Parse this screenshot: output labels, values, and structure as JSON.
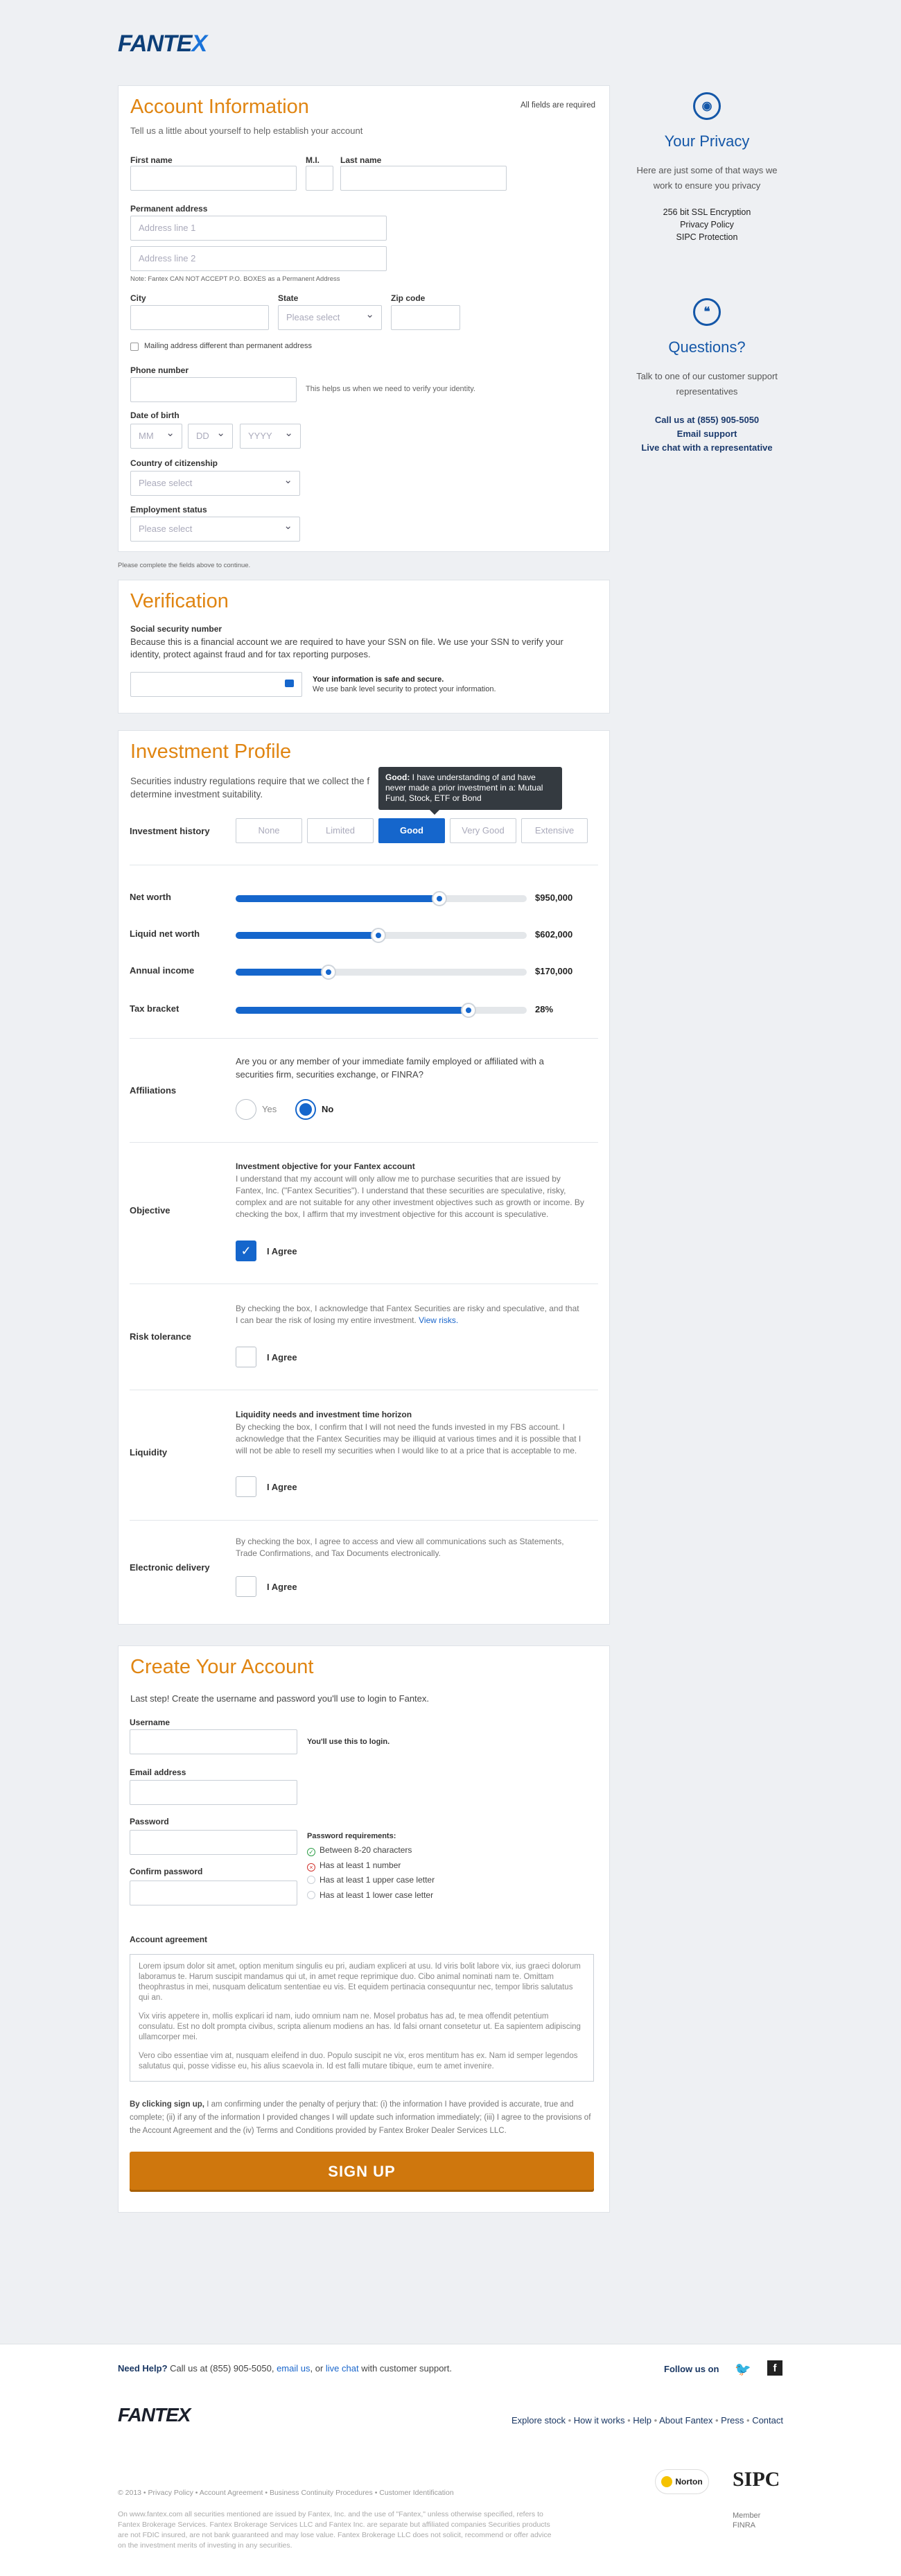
{
  "brand": {
    "logo_main": "FANTE",
    "logo_x": "X"
  },
  "account": {
    "title": "Account Information",
    "required_note": "All fields are required",
    "subtitle": "Tell us a little about yourself to help establish your account",
    "first_name_label": "First name",
    "mi_label": "M.I.",
    "last_name_label": "Last name",
    "address_label": "Permanent address",
    "address1_placeholder": "Address line 1",
    "address2_placeholder": "Address line 2",
    "address_note": "Note: Fantex CAN NOT ACCEPT P.O. BOXES as a Permanent Address",
    "city_label": "City",
    "state_label": "State",
    "state_placeholder": "Please select",
    "zip_label": "Zip code",
    "mailing_label": "Mailing address different than permanent address",
    "phone_label": "Phone number",
    "phone_help": "This helps us when we need to verify your identity.",
    "dob_label": "Date of birth",
    "dob_mm": "MM",
    "dob_dd": "DD",
    "dob_yyyy": "YYYY",
    "citizenship_label": "Country of citizenship",
    "citizenship_placeholder": "Please select",
    "employment_label": "Employment status",
    "employment_placeholder": "Please select",
    "complete_note": "Please complete the fields above to continue."
  },
  "verification": {
    "title": "Verification",
    "ssn_label": "Social security number",
    "ssn_text": "Because this is a financial account we are required to have your SSN on file. We use your SSN to verify your identity, protect against fraud and for tax reporting purposes.",
    "safe_title": "Your information is safe and secure.",
    "safe_text": "We use bank level security to protect your information."
  },
  "investment": {
    "title": "Investment Profile",
    "subtitle_1": "Securities industry regulations require that we collect the f",
    "subtitle_2": "determine investment suitability.",
    "tooltip_bold": "Good:",
    "tooltip_text": " I have understanding of and have never made a prior investment in a: Mutual Fund, Stock, ETF or Bond",
    "history_label": "Investment history",
    "history_options": [
      "None",
      "Limited",
      "Good",
      "Very Good",
      "Extensive"
    ],
    "history_selected": "Good",
    "sliders": [
      {
        "label": "Net worth",
        "value": "$950,000",
        "fraction": 0.7
      },
      {
        "label": "Liquid net worth",
        "value": "$602,000",
        "fraction": 0.49
      },
      {
        "label": "Annual income",
        "value": "$170,000",
        "fraction": 0.32
      },
      {
        "label": "Tax bracket",
        "value": "28%",
        "fraction": 0.8
      }
    ],
    "affiliations_label": "Affiliations",
    "affiliations_q": "Are you or any member of your immediate family employed or affiliated with a securities firm, securities exchange, or FINRA?",
    "yes": "Yes",
    "no": "No",
    "objective_label": "Objective",
    "objective_title": "Investment objective for your Fantex account",
    "objective_text": "I understand that my account will only allow me to purchase securities that are issued by Fantex, Inc. (\"Fantex Securities\"). I understand that these securities are speculative, risky, complex and are not suitable for any other investment objectives such as growth or income. By checking the box, I affirm that my investment objective for this account is speculative.",
    "agree": "I Agree",
    "risk_label": "Risk tolerance",
    "risk_text": "By checking the box, I acknowledge that Fantex Securities are risky and speculative, and that I can bear the risk of losing my entire investment.",
    "risk_link": "View risks.",
    "liquidity_label": "Liquidity",
    "liquidity_title": "Liquidity needs and investment time horizon",
    "liquidity_text": "By checking the box, I confirm that I will not need the funds invested in my FBS account. I acknowledge that the Fantex Securities may be illiquid at various times and it is possible that I will not be able to resell my securities when I would like to at a price that is acceptable to me.",
    "delivery_label": "Electronic delivery",
    "delivery_text": "By checking the box, I agree to access and view all communications such as Statements, Trade Confirmations, and Tax Documents electronically."
  },
  "create": {
    "title": "Create Your Account",
    "subtitle": "Last step! Create the username and password you'll use to login to Fantex.",
    "username_label": "Username",
    "username_help": "You'll use this to login.",
    "email_label": "Email address",
    "password_label": "Password",
    "confirm_label": "Confirm password",
    "req_title": "Password requirements:",
    "requirements": [
      "Between 8-20 characters",
      "Has at least 1 number",
      "Has at least 1 upper case letter",
      "Has at least 1 lower case letter"
    ],
    "agreement_label": "Account agreement",
    "agreement_p1": "Lorem ipsum dolor sit amet, option menitum singulis eu pri, audiam expliceri at usu. Id viris bolit labore vix, ius graeci dolorum laboramus te. Harum suscipit mandamus qui ut, in amet reque reprimique duo. Cibo animal nominati nam te. Omittam theophrastus in mei, nusquam delicatum sententiae eu vis. Et equidem pertinacia consequuntur nec, tempor libris salutatus qui an.",
    "agreement_p2": "Vix viris appetere in, mollis explicari id nam, iudo omnium nam ne. Mosel probatus has ad, te mea offendit petentium consulatu. Est no dolt prompta civibus, scripta alienum modiens an has. Id falsi ornant consetetur ut. Ea sapientem adipiscing ullamcorper mei.",
    "agreement_p3": "Vero cibo essentiae vim at, nusquam eleifend in duo. Populo suscipit ne vix, eros mentitum has ex. Nam id semper legendos salutatus qui, posse vidisse eu, his alius scaevola in. Id est falli mutare tibique, eum te amet invenire.",
    "signup_bold": "By clicking sign up,",
    "signup_text": " I am confirming under the penalty of perjury that: (i) the information I have provided is accurate, true and complete; (ii) if any of the information I provided changes I will update such information immediately; (iii) I agree to the provisions of the Account Agreement and the (iv) Terms and Conditions provided by Fantex Broker Dealer Services LLC.",
    "signup_button": "SIGN UP"
  },
  "privacy": {
    "title": "Your Privacy",
    "text": "Here are just some of that ways we work to ensure you privacy",
    "items": [
      "256 bit SSL Encryption",
      "Privacy Policy",
      "SIPC Protection"
    ]
  },
  "questions": {
    "title": "Questions?",
    "text": "Talk to one of our customer support representatives",
    "call": "Call us at (855) 905-5050",
    "email": "Email support",
    "chat": "Live chat with a representative"
  },
  "footer": {
    "need_help": "Need Help?",
    "help_text_1": " Call us at (855) 905-5050, ",
    "email": "email us",
    "help_text_2": ", or ",
    "chat": "live chat",
    "help_text_3": " with customer support.",
    "follow": "Follow us on",
    "nav": [
      "Explore stock",
      "How it works",
      "Help",
      "About Fantex",
      "Press",
      "Contact"
    ],
    "copyright": "© 2013 • Privacy Policy • Account Agreement • Business Continuity Procedures • Customer Identification",
    "disclaimer": "On www.fantex.com all securities mentioned are issued by Fantex, Inc. and the use of \"Fantex,\" unless otherwise specified, refers to Fantex Brokerage Services. Fantex Brokerage Services LLC and Fantex Inc. are separate but affiliated companies Securities products are not FDIC insured, are not bank guaranteed and may lose value. Fantex Brokerage LLC does not solicit, recommend or offer advice on the investment merits of investing in any securities.",
    "norton": "Norton",
    "sipc": "SIPC",
    "member": "Member FINRA"
  }
}
